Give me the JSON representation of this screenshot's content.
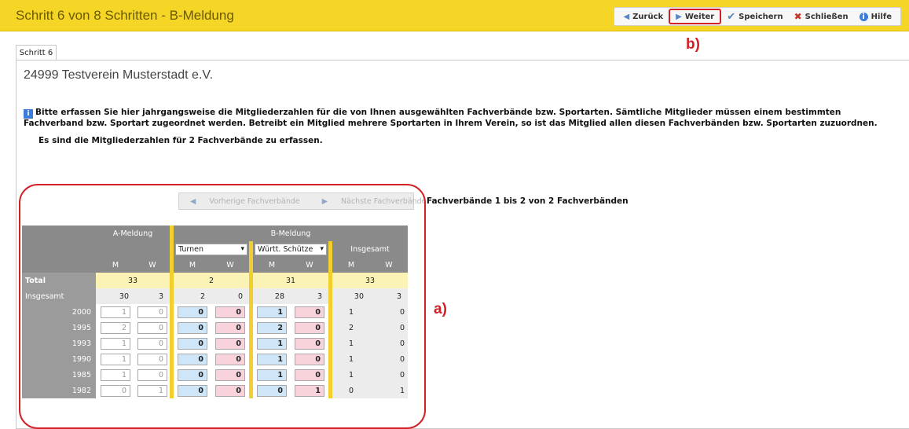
{
  "header": {
    "title": "Schritt 6 von 8 Schritten - B-Meldung",
    "toolbar": [
      {
        "label": "Zurück",
        "icon": "triangle-left-icon"
      },
      {
        "label": "Weiter",
        "icon": "triangle-right-icon"
      },
      {
        "label": "Speichern",
        "icon": "checkmark-icon"
      },
      {
        "label": "Schließen",
        "icon": "close-circle-icon"
      },
      {
        "label": "Hilfe",
        "icon": "info-icon"
      }
    ],
    "annotation_b": "b)"
  },
  "tab": {
    "label": "Schritt 6"
  },
  "club": {
    "name": "24999 Testverein Musterstadt e.V."
  },
  "info": {
    "text": "Bitte erfassen Sie hier jahrgangsweise die Mitgliederzahlen für die von Ihnen ausgewählten Fachverbände bzw. Sportarten. Sämtliche Mitglieder müssen einem bestimmten Fachverband bzw. Sportart zugeordnet werden. Betreibt ein Mitglied mehrere Sportarten in Ihrem Verein, so ist das Mitglied allen diesen Fachverbänden bzw. Sportarten zuzuordnen.",
    "count_text": "Es sind die Mitgliederzahlen für 2 Fachverbände zu erfassen."
  },
  "pager": {
    "prev": "Vorherige Fachverbände",
    "next": "Nächste Fachverbände",
    "status": "Fachverbände 1 bis 2 von 2 Fachverbänden"
  },
  "annotation_a": "a)",
  "grid": {
    "group_a": "A-Meldung",
    "group_b": "B-Meldung",
    "select_1": "Turnen",
    "select_2": "Württ. Schütze",
    "insgesamt_header": "Insgesamt",
    "m": "M",
    "w": "W",
    "total_label": "Total",
    "insgesamt_label": "Insgesamt",
    "total": {
      "a": "33",
      "turnen": "2",
      "schuetzen": "31",
      "sum": "33"
    },
    "insgesamt": [
      "30",
      "3",
      "2",
      "0",
      "28",
      "3",
      "30",
      "3"
    ],
    "rows": [
      {
        "year": "2000",
        "a_m": "1",
        "a_w": "0",
        "t_m": "0",
        "t_w": "0",
        "s_m": "1",
        "s_w": "0",
        "i_m": "1",
        "i_w": "0"
      },
      {
        "year": "1995",
        "a_m": "2",
        "a_w": "0",
        "t_m": "0",
        "t_w": "0",
        "s_m": "2",
        "s_w": "0",
        "i_m": "2",
        "i_w": "0"
      },
      {
        "year": "1993",
        "a_m": "1",
        "a_w": "0",
        "t_m": "0",
        "t_w": "0",
        "s_m": "1",
        "s_w": "0",
        "i_m": "1",
        "i_w": "0"
      },
      {
        "year": "1990",
        "a_m": "1",
        "a_w": "0",
        "t_m": "0",
        "t_w": "0",
        "s_m": "1",
        "s_w": "0",
        "i_m": "1",
        "i_w": "0"
      },
      {
        "year": "1985",
        "a_m": "1",
        "a_w": "0",
        "t_m": "0",
        "t_w": "0",
        "s_m": "1",
        "s_w": "0",
        "i_m": "1",
        "i_w": "0"
      },
      {
        "year": "1982",
        "a_m": "0",
        "a_w": "1",
        "t_m": "0",
        "t_w": "0",
        "s_m": "0",
        "s_w": "1",
        "i_m": "0",
        "i_w": "1"
      }
    ]
  },
  "colors": {
    "accent_yellow": "#f5d526",
    "annotation_red": "#d32027",
    "input_blue": "#cfe6f8",
    "input_pink": "#f8d3dc",
    "total_yellow": "#fbf3b6"
  }
}
